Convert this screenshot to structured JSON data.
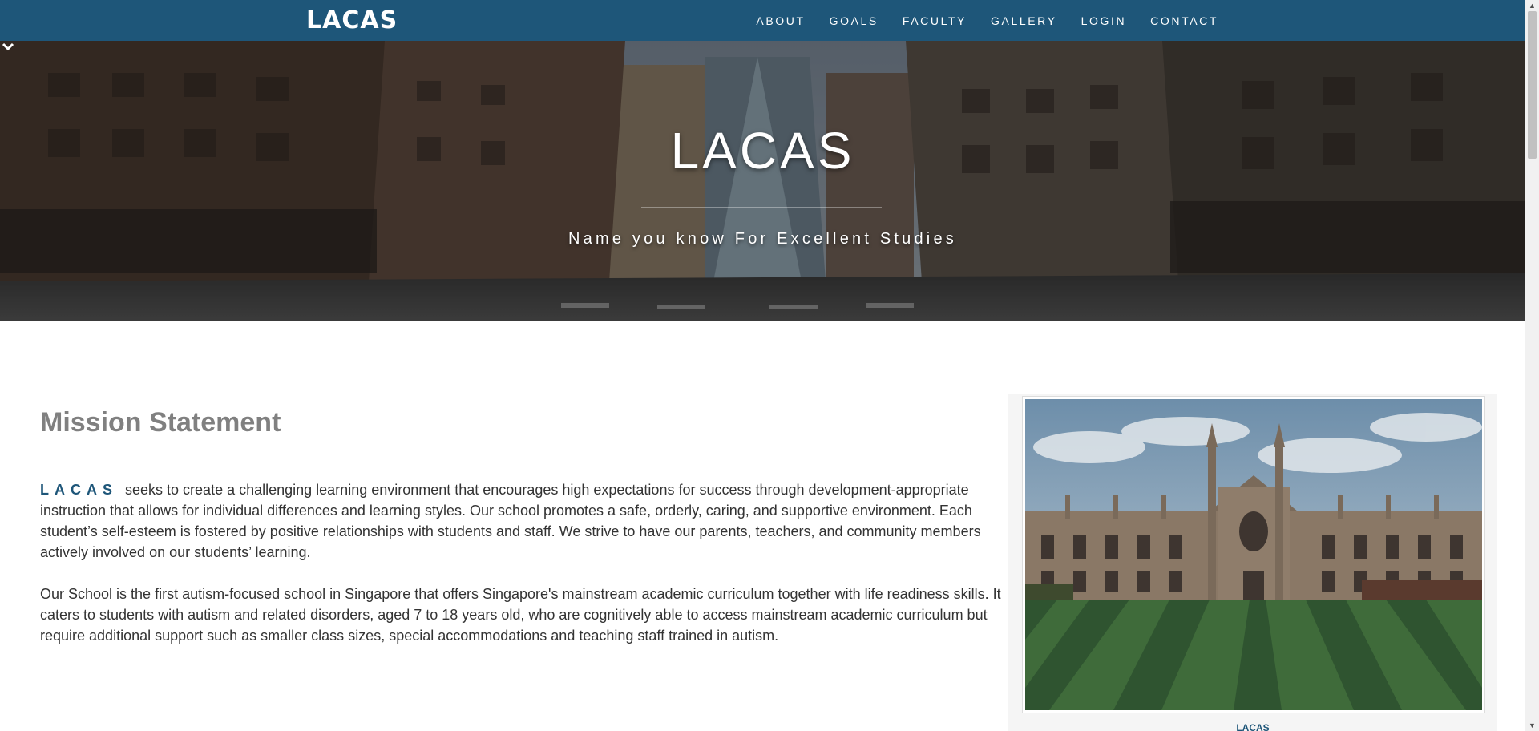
{
  "nav": {
    "brand": "LACAS",
    "links": [
      "ABOUT",
      "GOALS",
      "FACULTY",
      "GALLERY",
      "LOGIN",
      "CONTACT"
    ]
  },
  "hero": {
    "title": "LACAS",
    "subtitle": "Name you know For Excellent Studies",
    "chevron_icon": "chevron-down-icon"
  },
  "mission": {
    "heading": "Mission Statement",
    "brand_inline": "LACAS",
    "paragraph1": "seeks to create a challenging learning environment that encourages high expectations for success through development-appropriate instruction that allows for individual differences and learning styles. Our school promotes a safe, orderly, caring, and supportive environment. Each student’s self-esteem is fostered by positive relationships with students and staff. We strive to have our parents, teachers, and community members actively involved on our students’ learning.",
    "paragraph2": "Our School is the first autism-focused school in Singapore that offers Singapore's mainstream academic curriculum together with life readiness skills. It caters to students with autism and related disorders, aged 7 to 18 years old, who are cognitively able to access mainstream academic curriculum but require additional support such as smaller class sizes, special accommodations and teaching staff trained in autism."
  },
  "image_card": {
    "caption": "LACAS"
  },
  "colors": {
    "navbar": "#1e5679",
    "accent": "#1e5679",
    "heading": "#808080",
    "text": "#333333"
  }
}
